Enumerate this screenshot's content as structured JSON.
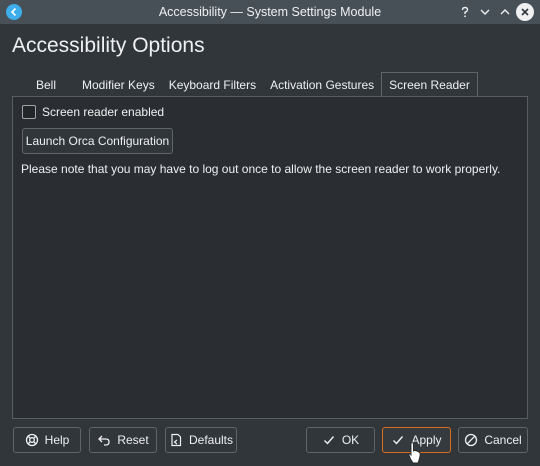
{
  "window": {
    "title": "Accessibility — System Settings Module",
    "accent": "#3daee9"
  },
  "page": {
    "heading": "Accessibility Options"
  },
  "tabs": [
    {
      "label": "Bell"
    },
    {
      "label": "Modifier Keys"
    },
    {
      "label": "Keyboard Filters"
    },
    {
      "label": "Activation Gestures"
    },
    {
      "label": "Screen Reader",
      "active": true
    }
  ],
  "screen_reader": {
    "enable_label": "Screen reader enabled",
    "enabled": false,
    "launch_label": "Launch Orca Configuration",
    "note": "Please note that you may have to log out once to allow the screen reader to work properly."
  },
  "buttons": {
    "help": "Help",
    "reset": "Reset",
    "defaults": "Defaults",
    "ok": "OK",
    "apply": "Apply",
    "cancel": "Cancel"
  },
  "colors": {
    "window_bg": "#31363b",
    "panel_bg": "#2a2e32",
    "titlebar_bg": "#475057",
    "focus": "#d66c1c"
  }
}
